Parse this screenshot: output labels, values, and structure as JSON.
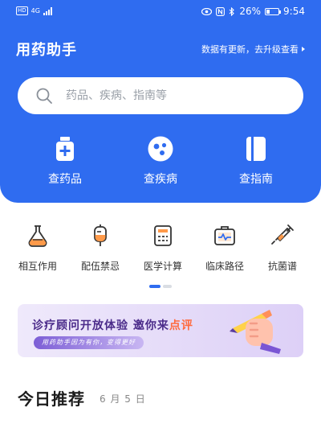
{
  "status_bar": {
    "network_label": "HD",
    "network_type": "4G",
    "battery_percent": "26%",
    "battery_level": 0.26,
    "time": "9:54"
  },
  "header": {
    "title": "用药助手",
    "update_link": "数据有更新，去升级查看"
  },
  "search": {
    "placeholder": "药品、疾病、指南等"
  },
  "quick_actions": [
    {
      "label": "查药品",
      "icon": "medicine-bottle-icon"
    },
    {
      "label": "查疾病",
      "icon": "virus-icon"
    },
    {
      "label": "查指南",
      "icon": "guide-book-icon"
    }
  ],
  "tools": [
    {
      "label": "相互作用",
      "icon": "flask-icon"
    },
    {
      "label": "配伍禁忌",
      "icon": "iv-bag-icon"
    },
    {
      "label": "医学计算",
      "icon": "calculator-icon"
    },
    {
      "label": "临床路径",
      "icon": "medical-case-icon"
    },
    {
      "label": "抗菌谱",
      "icon": "syringe-icon"
    }
  ],
  "pager": {
    "pages": 2,
    "active": 1
  },
  "banner": {
    "headline_main": "诊疗顾问开放体验  邀你来",
    "headline_accent": "点评",
    "subline": "用药助手因为有你，变得更好"
  },
  "recommend": {
    "title": "今日推荐",
    "date": "6 月 5 日"
  },
  "colors": {
    "primary": "#2f6cf0",
    "banner_text": "#4b2b8a",
    "accent": "#ff6a3d"
  }
}
